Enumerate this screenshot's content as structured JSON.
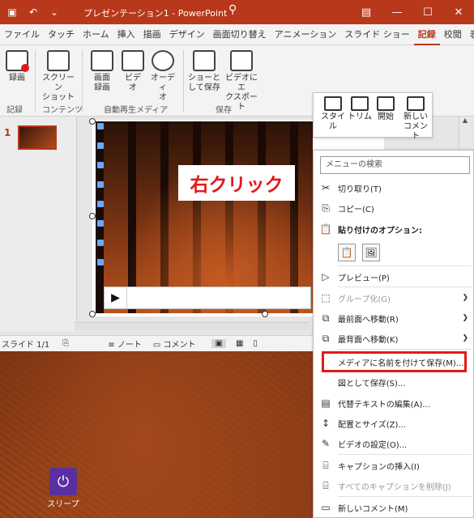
{
  "window": {
    "title": "プレゼンテーション1 - PowerPoint",
    "colors": {
      "titlebar": "#b8381b",
      "accent": "#e01a1a"
    }
  },
  "titlebar": {
    "save_icon": "save-icon",
    "undo_icon": "undo-icon",
    "search_icon": "search-icon",
    "controls": [
      "ribbon-display-icon",
      "minimize-icon",
      "maximize-icon",
      "close-icon"
    ]
  },
  "tabs": [
    {
      "label": "ファイル"
    },
    {
      "label": "タッチ"
    },
    {
      "label": "ホーム"
    },
    {
      "label": "挿入"
    },
    {
      "label": "描画"
    },
    {
      "label": "デザイン"
    },
    {
      "label": "画面切り替え"
    },
    {
      "label": "アニメーション"
    },
    {
      "label": "スライド ショー"
    },
    {
      "label": "記録"
    },
    {
      "label": "校閲"
    },
    {
      "label": "表示"
    }
  ],
  "ribbon": {
    "buttons": [
      {
        "label1": "録画",
        "label2": ""
      },
      {
        "label1": "スクリーン",
        "label2": "ショット"
      },
      {
        "label1": "画面",
        "label2": "録画"
      },
      {
        "label1": "ビデ",
        "label2": "オ"
      },
      {
        "label1": "オーディ",
        "label2": "オ"
      },
      {
        "label1": "ショーと",
        "label2": "して保存"
      },
      {
        "label1": "ビデオにエ",
        "label2": "クスポート"
      }
    ],
    "groups": [
      {
        "label": "記録"
      },
      {
        "label": "コンテンツ"
      },
      {
        "label": "自動再生メディア"
      },
      {
        "label": "保存"
      }
    ]
  },
  "editor": {
    "slide_number": "1",
    "callout": "右クリック"
  },
  "mini_toolbar": [
    {
      "label1": "スタイル",
      "label2": ""
    },
    {
      "label1": "トリム",
      "label2": ""
    },
    {
      "label1": "開始",
      "label2": ""
    },
    {
      "label1": "新しい",
      "label2": "コメント"
    }
  ],
  "status": {
    "slide": "スライド 1/1",
    "notes": "ノート",
    "comments": "コメント"
  },
  "desktop": {
    "sleep_label": "スリープ"
  },
  "context_menu": {
    "search_placeholder": "メニューの検索",
    "items": [
      {
        "label": "切り取り(T)"
      },
      {
        "label": "コピー(C)"
      },
      {
        "label": "貼り付けのオプション:"
      },
      {
        "label": "プレビュー(P)"
      },
      {
        "label": "グループ化(G)"
      },
      {
        "label": "最前面へ移動(R)"
      },
      {
        "label": "最背面へ移動(K)"
      },
      {
        "label": "メディアに名前を付けて保存(M)..."
      },
      {
        "label": "図として保存(S)..."
      },
      {
        "label": "代替テキストの編集(A)..."
      },
      {
        "label": "配置とサイズ(Z)..."
      },
      {
        "label": "ビデオの設定(O)..."
      },
      {
        "label": "キャプションの挿入(I)"
      },
      {
        "label": "すべてのキャプションを削除(J)"
      },
      {
        "label": "新しいコメント(M)"
      }
    ]
  }
}
